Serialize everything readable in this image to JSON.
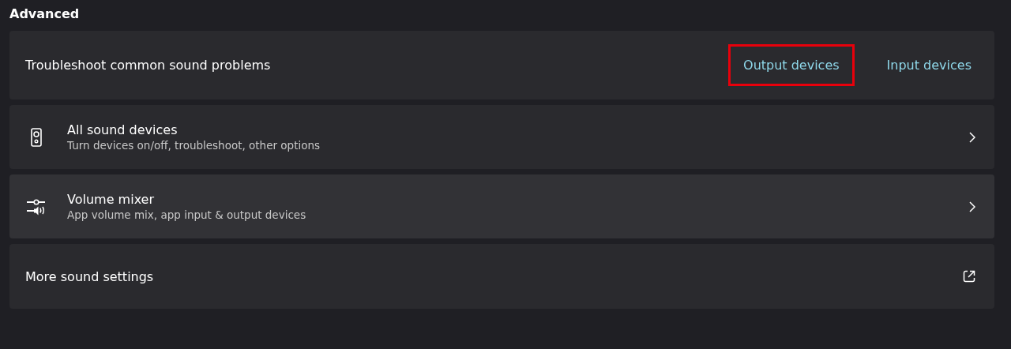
{
  "section_title": "Advanced",
  "rows": [
    {
      "kind": "troubleshoot",
      "title": "Troubleshoot common sound problems",
      "links": [
        {
          "label": "Output devices",
          "highlighted": true
        },
        {
          "label": "Input devices",
          "highlighted": false
        }
      ]
    },
    {
      "kind": "nav",
      "title": "All sound devices",
      "subtitle": "Turn devices on/off, troubleshoot, other options"
    },
    {
      "kind": "nav",
      "title": "Volume mixer",
      "subtitle": "App volume mix, app input & output devices"
    },
    {
      "kind": "external",
      "title": "More sound settings"
    }
  ]
}
